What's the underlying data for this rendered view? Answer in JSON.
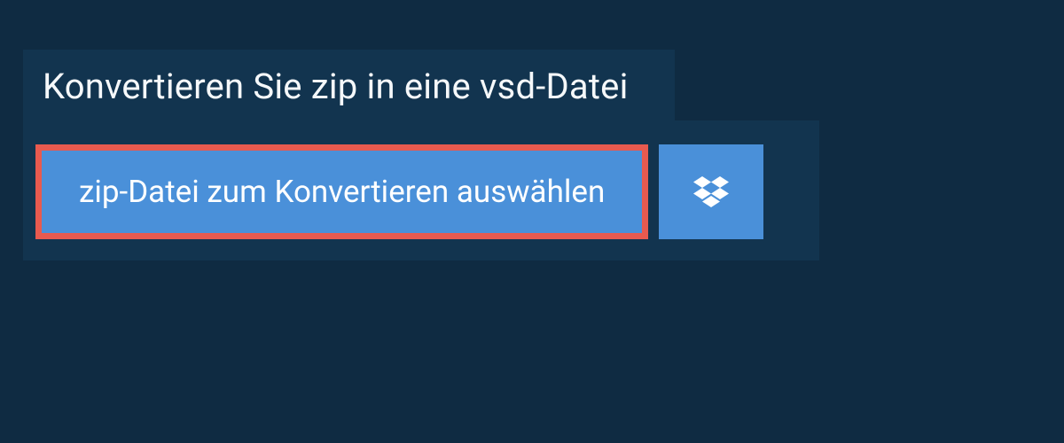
{
  "header": {
    "title": "Konvertieren Sie zip in eine vsd-Datei"
  },
  "actions": {
    "select_file_label": "zip-Datei zum Konvertieren auswählen",
    "dropbox_icon": "dropbox-icon"
  },
  "colors": {
    "background": "#0f2b42",
    "panel": "#12344f",
    "button": "#4a90d9",
    "highlight_border": "#e85a4f"
  }
}
